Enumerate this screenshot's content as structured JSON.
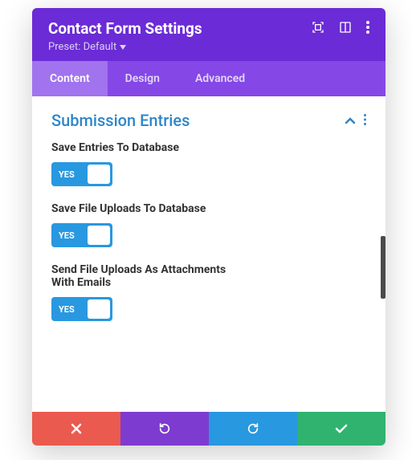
{
  "header": {
    "title": "Contact Form Settings",
    "preset_label": "Preset: Default"
  },
  "tabs": {
    "content": "Content",
    "design": "Design",
    "advanced": "Advanced",
    "active": "content"
  },
  "section": {
    "title": "Submission Entries"
  },
  "settings": [
    {
      "label": "Save Entries To Database",
      "toggle": "YES"
    },
    {
      "label": "Save File Uploads To Database",
      "toggle": "YES"
    },
    {
      "label": "Send File Uploads As Attachments With Emails",
      "toggle": "YES"
    }
  ]
}
